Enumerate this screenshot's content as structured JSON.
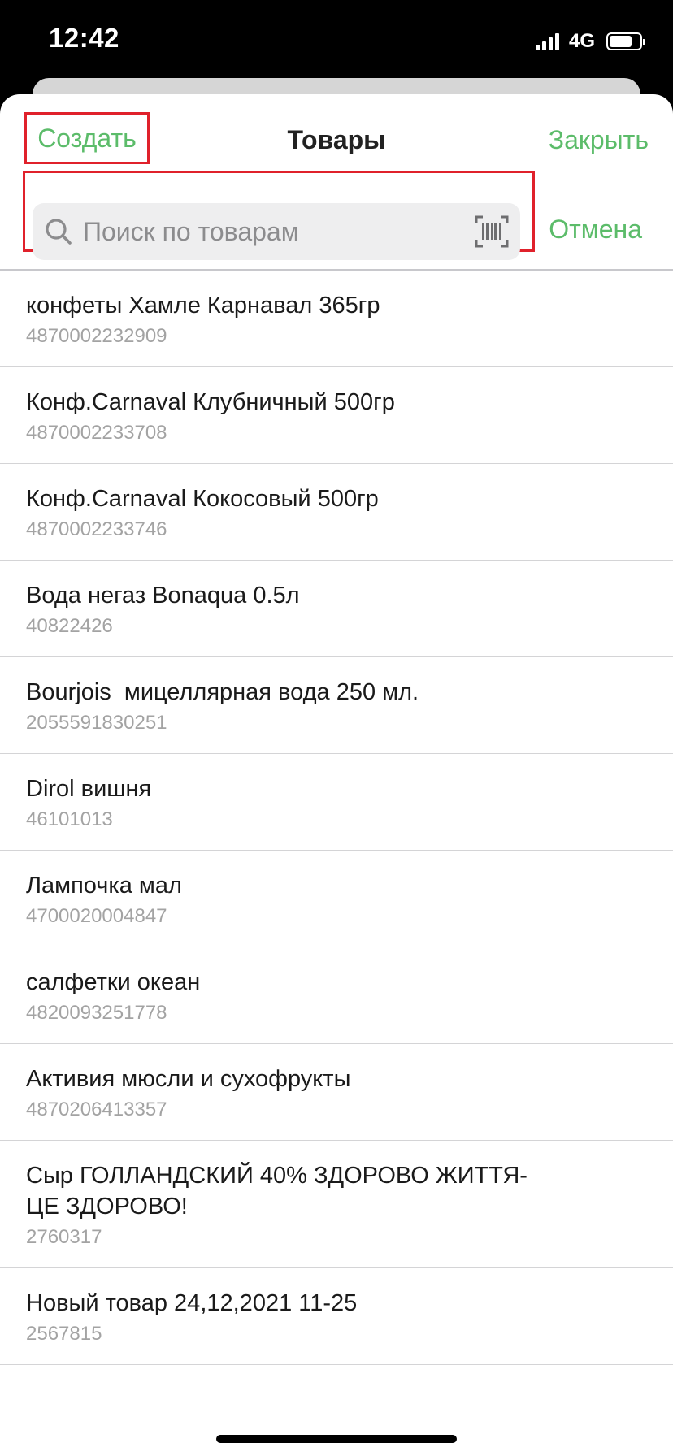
{
  "status_bar": {
    "time": "12:42",
    "network": "4G",
    "battery_level": 0.75
  },
  "nav": {
    "create_label": "Создать",
    "title": "Товары",
    "close_label": "Закрыть"
  },
  "search": {
    "placeholder": "Поиск по товарам",
    "value": "",
    "cancel_label": "Отмена"
  },
  "colors": {
    "accent": "#5cbc6a",
    "highlight": "#e0212b"
  },
  "products": [
    {
      "name": "конфеты Хамле Карнавал 365гр",
      "code": "4870002232909"
    },
    {
      "name": "Конф.Carnaval Клубничный 500гр",
      "code": "4870002233708"
    },
    {
      "name": "Конф.Carnaval Кокосовый 500гр",
      "code": "4870002233746"
    },
    {
      "name": "Вода негаз Bonaqua 0.5л",
      "code": "40822426"
    },
    {
      "name": "Bourjois  мицеллярная вода 250 мл.",
      "code": "2055591830251"
    },
    {
      "name": "Dirol вишня",
      "code": "46101013"
    },
    {
      "name": "Лампочка мал",
      "code": "4700020004847"
    },
    {
      "name": "салфетки океан",
      "code": "4820093251778"
    },
    {
      "name": "Активия мюсли и сухофрукты",
      "code": "4870206413357"
    },
    {
      "name": "Сыр ГОЛЛАНДСКИЙ 40% ЗДОРОВО ЖИТТЯ-\nЦЕ ЗДОРОВО!",
      "code": "2760317"
    },
    {
      "name": "Новый товар 24,12,2021 11-25",
      "code": "2567815"
    }
  ]
}
